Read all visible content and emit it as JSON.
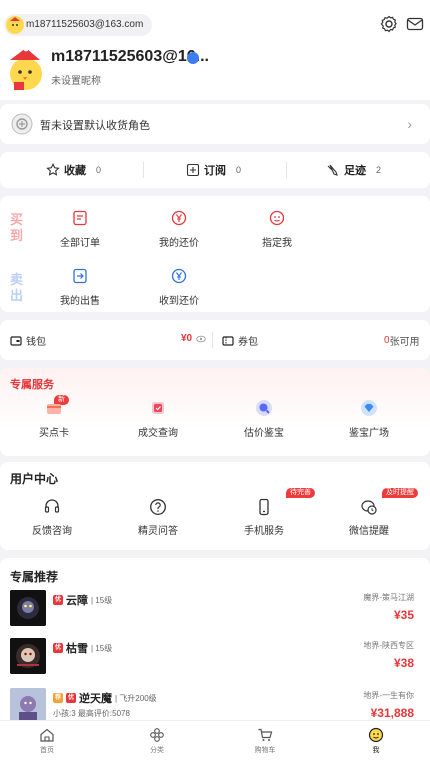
{
  "header": {
    "account_pill": "m18711525603@163.com",
    "settings_icon": "gear-icon",
    "message_icon": "mail-icon"
  },
  "profile": {
    "username": "m18711525603@16...",
    "nickname": "未设置昵称"
  },
  "role": {
    "text": "暂未设置默认收货角色",
    "chevron": "›"
  },
  "favorites": [
    {
      "label": "收藏",
      "count": "0",
      "icon": "star-icon"
    },
    {
      "label": "订阅",
      "count": "0",
      "icon": "subscribe-icon"
    },
    {
      "label": "足迹",
      "count": "2",
      "icon": "footprint-icon"
    }
  ],
  "orders": {
    "buy_label": "买到",
    "sell_label": "卖出",
    "buy_items": [
      {
        "label": "全部订单",
        "icon": "order-list-icon"
      },
      {
        "label": "我的还价",
        "icon": "yen-icon"
      },
      {
        "label": "指定我",
        "icon": "smile-icon"
      }
    ],
    "sell_items": [
      {
        "label": "我的出售",
        "icon": "sell-icon"
      },
      {
        "label": "收到还价",
        "icon": "yen-icon"
      }
    ]
  },
  "wallet": {
    "wallet_label": "钱包",
    "wallet_amount": "¥0",
    "coupon_label": "券包",
    "coupon_count": "0",
    "coupon_suffix": "张可用"
  },
  "exclusive_service": {
    "title": "专属服务",
    "new_tag": "新",
    "items": [
      {
        "label": "买点卡",
        "icon": "card-icon"
      },
      {
        "label": "成交查询",
        "icon": "deal-query-icon"
      },
      {
        "label": "估价鉴宝",
        "icon": "appraise-icon"
      },
      {
        "label": "鉴宝广场",
        "icon": "diamond-icon"
      }
    ]
  },
  "user_center": {
    "title": "用户中心",
    "items": [
      {
        "label": "反馈咨询",
        "icon": "headset-icon"
      },
      {
        "label": "精灵问答",
        "icon": "question-icon"
      },
      {
        "label": "手机服务",
        "icon": "phone-icon"
      },
      {
        "label": "微信提醒",
        "icon": "wechat-icon"
      }
    ],
    "tag_phone": "待完善",
    "tag_wechat": "及时提醒"
  },
  "recommend": {
    "title": "专属推荐",
    "items": [
      {
        "name": "云障",
        "level": "| 15级",
        "server": "魔界-策马江湖",
        "price": "¥35",
        "sub": ""
      },
      {
        "name": "枯雪",
        "level": "| 15级",
        "server": "地界-陕西专区",
        "price": "¥38",
        "sub": ""
      },
      {
        "name": "逆天魔",
        "level": "| 飞升200级",
        "server": "地界-一生有你",
        "price": "¥31,888",
        "sub": "小孩:3 最高评价:5078"
      }
    ]
  },
  "tabbar": [
    {
      "label": "首页",
      "icon": "home-icon"
    },
    {
      "label": "分类",
      "icon": "category-icon"
    },
    {
      "label": "购物车",
      "icon": "cart-icon"
    },
    {
      "label": "我",
      "icon": "me-icon"
    }
  ],
  "colors": {
    "accent_red": "#e8363b",
    "blue": "#3d7df0",
    "orange": "#f7a237"
  }
}
